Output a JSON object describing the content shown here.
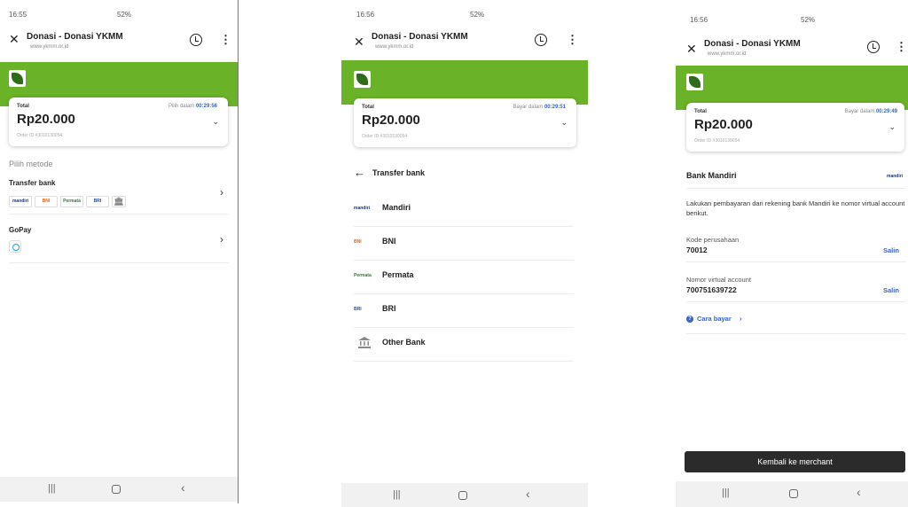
{
  "colors": {
    "accent_green": "#6ab227",
    "link_blue": "#3a63c8",
    "dark_button": "#2b2b2b"
  },
  "screen1": {
    "status_time": "16:55",
    "status_right": "52%",
    "title": "Donasi - Donasi YKMM",
    "url": "www.ykmm.or.id",
    "total_label": "Total",
    "amount": "Rp20.000",
    "order_id": "Order ID #3010130054",
    "timer_label": "Pilih dalam",
    "timer_value": "00:29:56",
    "section_label": "Pilih metode",
    "transfer_title": "Transfer bank",
    "bank_chips": [
      "mandiri",
      "BNI",
      "Permata",
      "BRI"
    ],
    "gopay_title": "GoPay",
    "icons": [
      "close-icon",
      "history-icon",
      "more-vert-icon",
      "chevron-down-icon",
      "chevron-right-icon",
      "bank-building-icon",
      "gopay-icon"
    ]
  },
  "screen2": {
    "status_time": "16:56",
    "status_right": "52%",
    "title": "Donasi - Donasi YKMM",
    "url": "www.ykmm.or.id",
    "total_label": "Total",
    "amount": "Rp20.000",
    "order_id": "Order ID #3010130054",
    "timer_label": "Bayar dalam",
    "timer_value": "00:29:51",
    "heading": "Transfer bank",
    "banks": [
      {
        "name": "Mandiri",
        "logo": "mandiri"
      },
      {
        "name": "BNI",
        "logo": "BNI"
      },
      {
        "name": "Permata",
        "logo": "Permata"
      },
      {
        "name": "BRI",
        "logo": "BRI"
      },
      {
        "name": "Other Bank",
        "logo": ""
      }
    ]
  },
  "screen3": {
    "status_time": "16:56",
    "status_right": "52%",
    "title": "Donasi - Donasi YKMM",
    "url": "www.ykmm.or.id",
    "total_label": "Total",
    "amount": "Rp20.000",
    "order_id": "Order ID #3010130054",
    "timer_label": "Bayar dalam",
    "timer_value": "00:29:49",
    "bank_name": "Bank Mandiri",
    "bank_logo": "mandiri",
    "instruction": "Lakukan pembayaran dari rekening bank Mandiri ke nomor virtual account berikut.",
    "company_code_label": "Kode perusahaan",
    "company_code": "70012",
    "va_label": "Nomor virtual account",
    "va_number": "700751639722",
    "copy_label": "Salin",
    "how_to_pay": "Cara bayar",
    "back_button": "Kembali ke merchant"
  }
}
